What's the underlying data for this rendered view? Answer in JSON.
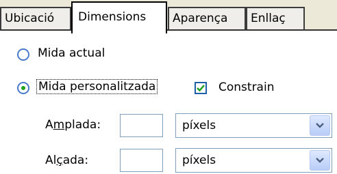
{
  "tabs": [
    {
      "label": "Ubicació",
      "active": false
    },
    {
      "label": "Dimensions",
      "active": true
    },
    {
      "label": "Aparença",
      "active": false
    },
    {
      "label": "Enllaç",
      "active": false
    }
  ],
  "size_mode": {
    "actual": {
      "label": "Mida actual",
      "selected": false
    },
    "custom": {
      "label": "Mida personalitzada",
      "selected": true
    }
  },
  "constrain": {
    "label": "Constrain",
    "checked": true
  },
  "width": {
    "label_pre": "A",
    "label_mnemonic": "m",
    "label_post": "plada:",
    "value": "",
    "unit": "píxels"
  },
  "height": {
    "label_pre": "Al",
    "label_mnemonic": "ç",
    "label_post": "ada:",
    "value": "",
    "unit": "píxels"
  },
  "colors": {
    "radio_dot": "#21a121",
    "checkmark": "#21a121",
    "border_blue": "#7f9db9"
  }
}
